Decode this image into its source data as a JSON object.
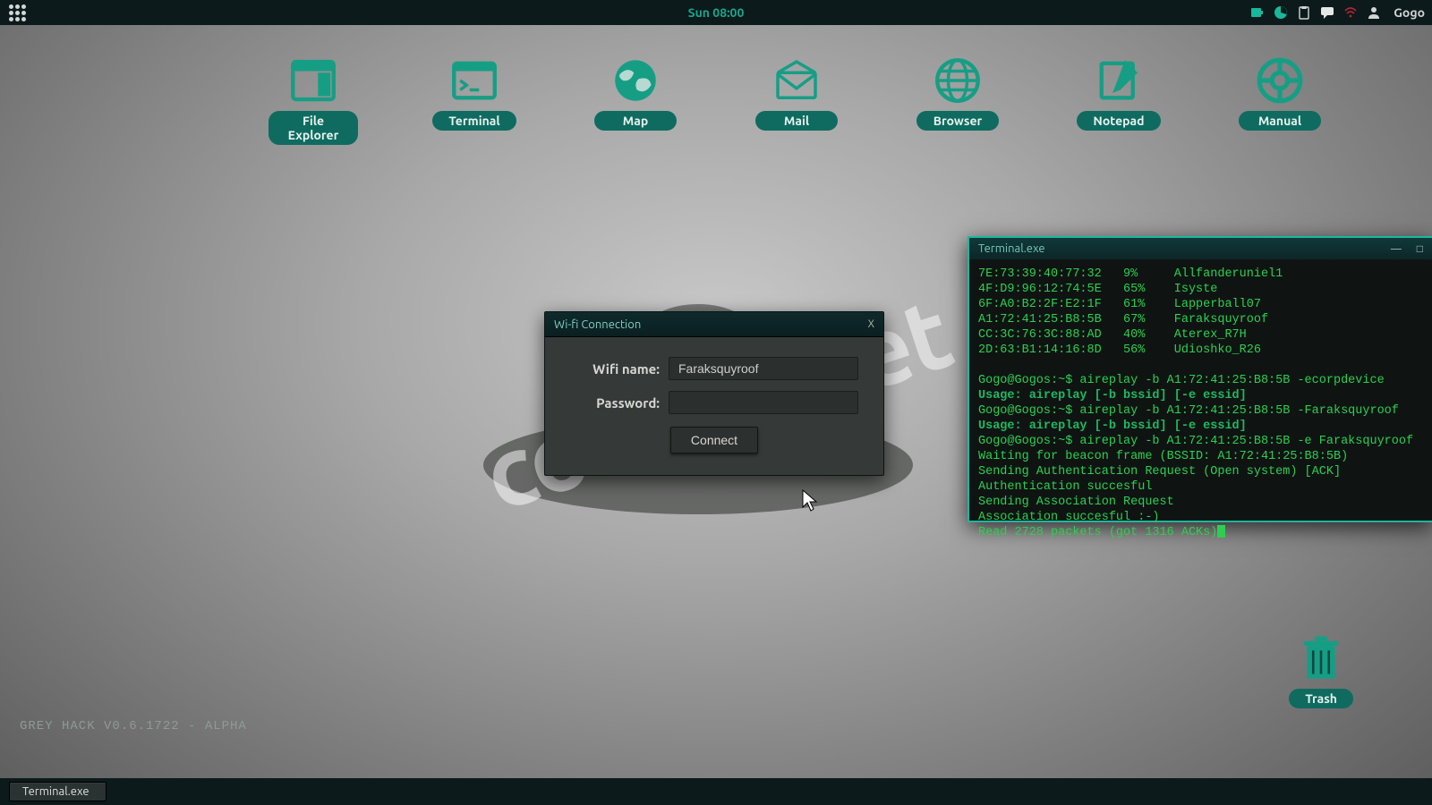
{
  "topbar": {
    "clock": "Sun 08:00",
    "username": "Gogo"
  },
  "desktop_icons": [
    {
      "label": "File Explorer"
    },
    {
      "label": "Terminal"
    },
    {
      "label": "Map"
    },
    {
      "label": "Mail"
    },
    {
      "label": "Browser"
    },
    {
      "label": "Notepad"
    },
    {
      "label": "Manual"
    }
  ],
  "wifi_window": {
    "title": "Wi-fi Connection",
    "name_label": "Wifi name:",
    "password_label": "Password:",
    "name_value": "Faraksquyroof",
    "password_value": "",
    "connect_label": "Connect",
    "close_label": "X"
  },
  "terminal_window": {
    "title": "Terminal.exe",
    "networks": [
      {
        "bssid": "7E:73:39:40:77:32",
        "signal": "9%",
        "essid": "Allfanderuniel1"
      },
      {
        "bssid": "4F:D9:96:12:74:5E",
        "signal": "65%",
        "essid": "Isyste"
      },
      {
        "bssid": "6F:A0:B2:2F:E2:1F",
        "signal": "61%",
        "essid": "Lapperball07"
      },
      {
        "bssid": "A1:72:41:25:B8:5B",
        "signal": "67%",
        "essid": "Faraksquyroof"
      },
      {
        "bssid": "CC:3C:76:3C:88:AD",
        "signal": "40%",
        "essid": "Aterex_R7H"
      },
      {
        "bssid": "2D:63:B1:14:16:8D",
        "signal": "56%",
        "essid": "Udioshko_R26"
      }
    ],
    "lines": [
      {
        "t": "Gogo@Gogos:~$ aireplay -b A1:72:41:25:B8:5B -ecorpdevice",
        "c": "normal"
      },
      {
        "t": "Usage: aireplay [-b bssid] [-e essid]",
        "c": "usage"
      },
      {
        "t": "Gogo@Gogos:~$ aireplay -b A1:72:41:25:B8:5B -Faraksquyroof",
        "c": "normal"
      },
      {
        "t": "Usage: aireplay [-b bssid] [-e essid]",
        "c": "usage"
      },
      {
        "t": "Gogo@Gogos:~$ aireplay -b A1:72:41:25:B8:5B -e Faraksquyroof",
        "c": "normal"
      },
      {
        "t": "Waiting for beacon frame (BSSID: A1:72:41:25:B8:5B)",
        "c": "normal"
      },
      {
        "t": "Sending Authentication Request (Open system) [ACK]",
        "c": "normal"
      },
      {
        "t": "Authentication succesful",
        "c": "normal"
      },
      {
        "t": "Sending Association Request",
        "c": "normal"
      },
      {
        "t": "Association succesful :-)",
        "c": "normal"
      },
      {
        "t": "Read 2728 packets (got 1316 ACKs)",
        "c": "normal"
      }
    ]
  },
  "trash": {
    "label": "Trash"
  },
  "version": "GREY HACK V0.6.1722 - ALPHA",
  "taskbar": {
    "item": "Terminal.exe"
  },
  "watermark": "codeby.net",
  "colors": {
    "accent": "#169e85",
    "teal_label": "#0f6b5f",
    "term_green": "#2ccf4f"
  }
}
